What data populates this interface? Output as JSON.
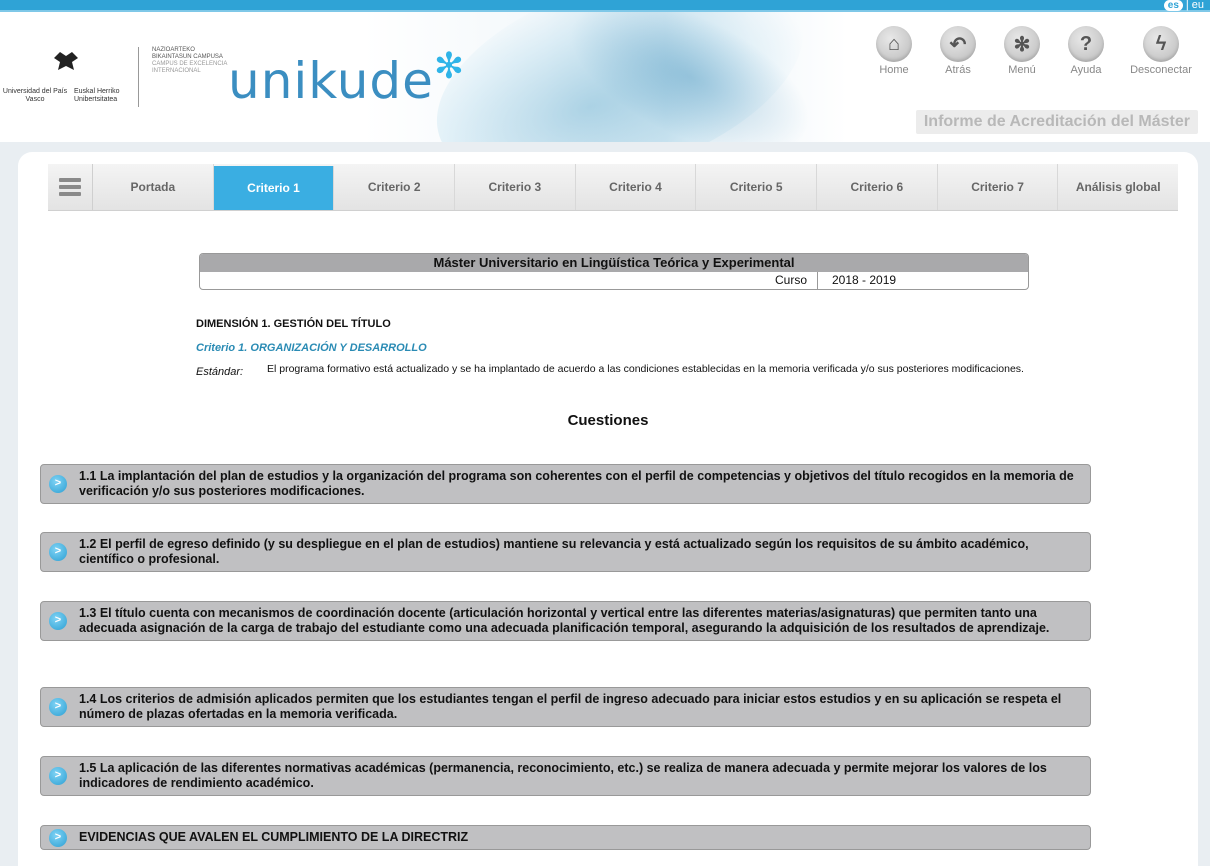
{
  "lang": {
    "active": "es",
    "separator": "|",
    "other": "eu"
  },
  "branding": {
    "upv_line1": "Universidad del País Vasco",
    "upv_line2": "Euskal Herriko Unibertsitatea",
    "campus_line1": "NAZIOARTEKO BIKAINTASUN CAMPUSA",
    "campus_line2": "CAMPUS DE EXCELENCIA INTERNACIONAL",
    "app_name": "unikude"
  },
  "nav": [
    {
      "icon": "home-icon",
      "glyph": "⌂",
      "label": "Home"
    },
    {
      "icon": "back-icon",
      "glyph": "↶",
      "label": "Atrás"
    },
    {
      "icon": "menu-icon",
      "glyph": "✻",
      "label": "Menú"
    },
    {
      "icon": "help-icon",
      "glyph": "?",
      "label": "Ayuda"
    },
    {
      "icon": "power-icon",
      "glyph": "ϟ",
      "label": "Desconectar"
    }
  ],
  "report_title": "Informe de Acreditación del Máster",
  "tabs": [
    {
      "label": "Portada",
      "active": false
    },
    {
      "label": "Criterio 1",
      "active": true
    },
    {
      "label": "Criterio 2",
      "active": false
    },
    {
      "label": "Criterio 3",
      "active": false
    },
    {
      "label": "Criterio 4",
      "active": false
    },
    {
      "label": "Criterio 5",
      "active": false
    },
    {
      "label": "Criterio 6",
      "active": false
    },
    {
      "label": "Criterio 7",
      "active": false
    },
    {
      "label": "Análisis global",
      "active": false
    }
  ],
  "master": {
    "title": "Máster Universitario en Lingüística Teórica y Experimental",
    "course_label": "Curso",
    "course_value": "2018  -  2019"
  },
  "dimension": "DIMENSIÓN 1. GESTIÓN DEL TÍTULO",
  "criterion": "Criterio 1. ORGANIZACIÓN Y DESARROLLO",
  "standard_label": "Estándar:",
  "standard_text": "El programa formativo está actualizado y se ha implantado de acuerdo a las condiciones establecidas en la memoria verificada y/o sus posteriores modificaciones.",
  "questions_heading": "Cuestiones",
  "questions": [
    "1.1  La implantación del plan de estudios y la organización del programa son coherentes con el perfil de competencias y objetivos del título recogidos en la memoria de verificación y/o sus posteriores modificaciones.",
    "1.2  El perfil de egreso definido (y su despliegue en el plan de estudios) mantiene su relevancia y está actualizado según los requisitos de su ámbito académico, científico o profesional.",
    "1.3  El título cuenta con mecanismos de coordinación docente (articulación horizontal y vertical entre las diferentes materias/asignaturas) que permiten tanto una adecuada asignación de la carga de trabajo del estudiante como una adecuada planificación temporal, asegurando la adquisición de los resultados de aprendizaje.",
    "1.4  Los criterios de admisión aplicados permiten que los estudiantes tengan el perfil de ingreso adecuado para iniciar estos estudios y en su aplicación se respeta el número de plazas ofertadas en la memoria verificada.",
    "1.5  La aplicación de las diferentes normativas académicas (permanencia, reconocimiento, etc.) se realiza de manera adecuada y permite mejorar los valores de los indicadores de rendimiento académico.",
    "EVIDENCIAS QUE AVALEN EL CUMPLIMIENTO DE LA DIRECTRIZ"
  ],
  "arrow_glyph": ">"
}
